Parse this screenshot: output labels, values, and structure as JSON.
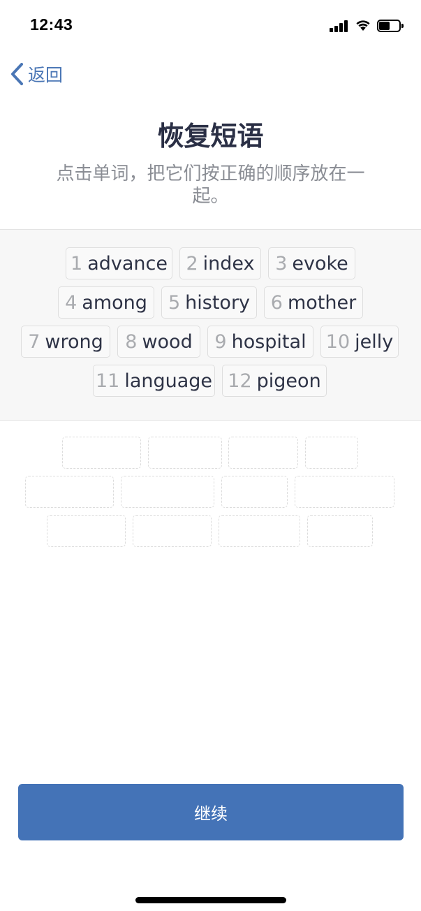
{
  "status_bar": {
    "time": "12:43",
    "icons": [
      "cellular-signal-icon",
      "wifi-icon",
      "battery-icon"
    ]
  },
  "nav": {
    "back_label": "返回"
  },
  "header": {
    "title": "恢复短语",
    "subtitle": "点击单词，把它们按正确的顺序放在一起。"
  },
  "word_bank": {
    "words": [
      {
        "num": "1",
        "word": "advance"
      },
      {
        "num": "2",
        "word": "index"
      },
      {
        "num": "3",
        "word": "evoke"
      },
      {
        "num": "4",
        "word": "among"
      },
      {
        "num": "5",
        "word": "history"
      },
      {
        "num": "6",
        "word": "mother"
      },
      {
        "num": "7",
        "word": "wrong"
      },
      {
        "num": "8",
        "word": "wood"
      },
      {
        "num": "9",
        "word": "hospital"
      },
      {
        "num": "10",
        "word": "jelly"
      },
      {
        "num": "11",
        "word": "language"
      },
      {
        "num": "12",
        "word": "pigeon"
      }
    ]
  },
  "answer_area": {
    "selected_count": 0,
    "total_slots": 12
  },
  "footer": {
    "continue_label": "继续"
  },
  "colors": {
    "accent": "#4473b7",
    "link": "#4a76b5",
    "title": "#2a2f45",
    "subtitle": "#8a8d94"
  }
}
